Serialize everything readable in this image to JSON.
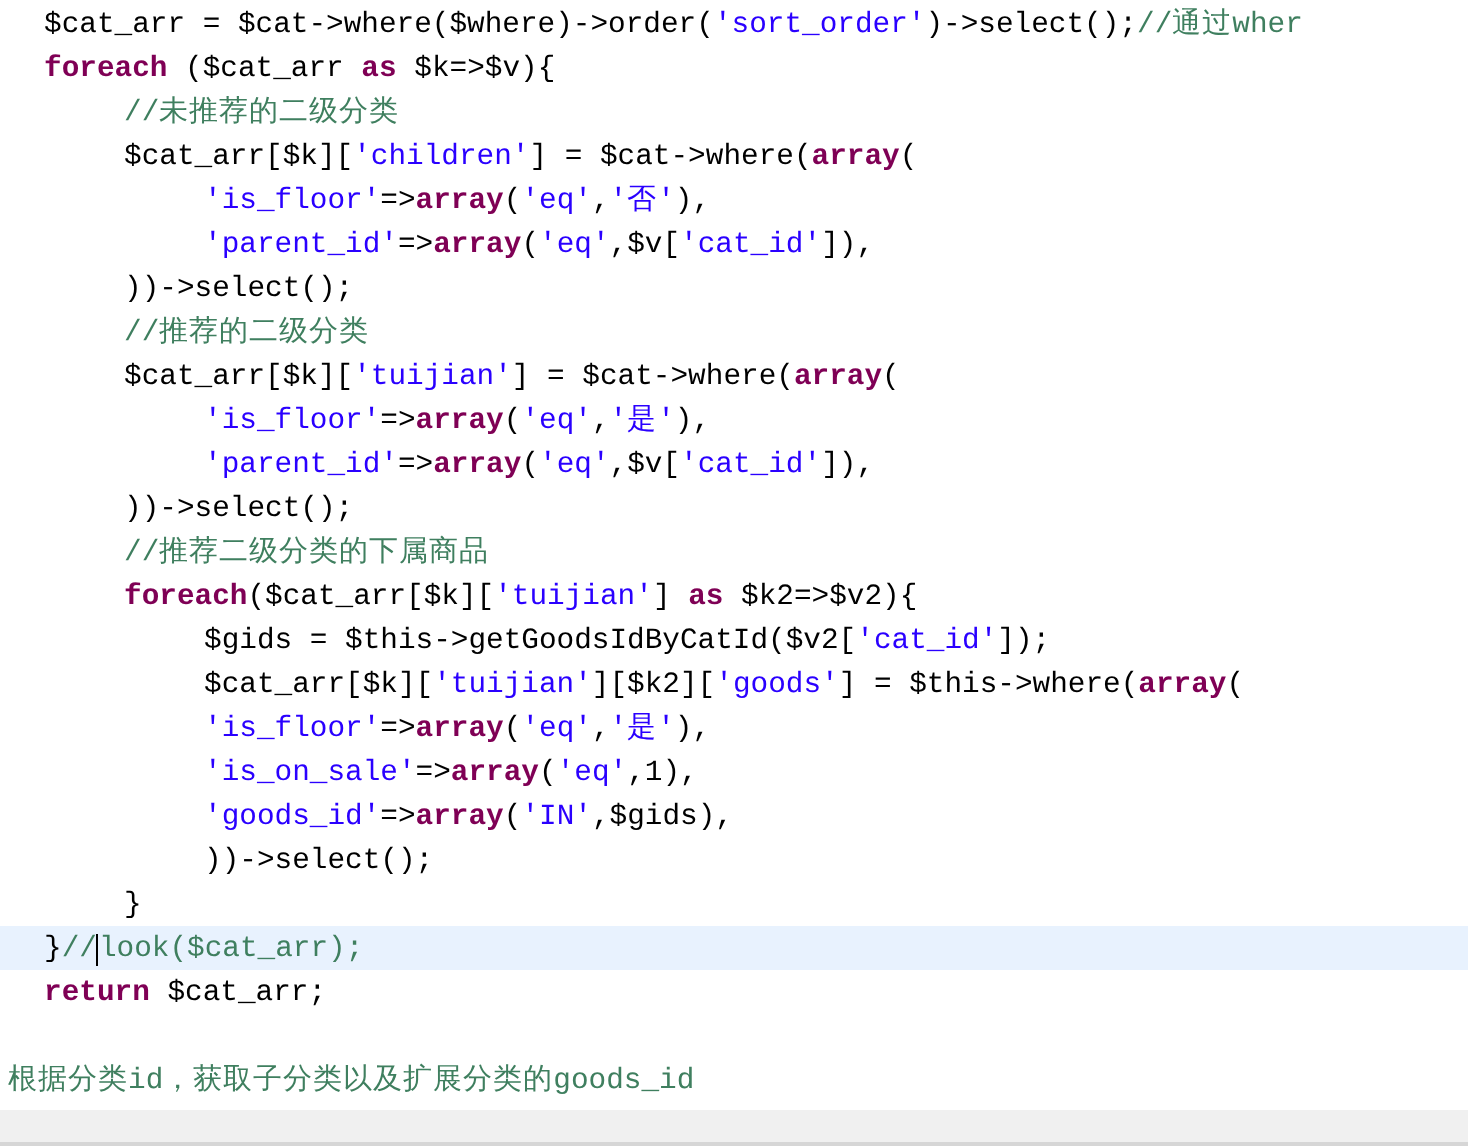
{
  "editor": {
    "blocks": [
      {
        "lines": [
          {
            "tokens": [
              {
                "kind": "plain",
                "text": "\t$cat_arr = $cat->where($where)->order("
              },
              {
                "kind": "string",
                "text": "'sort_order'"
              },
              {
                "kind": "plain",
                "text": ")->select();"
              },
              {
                "kind": "comment",
                "text": "//通过wher"
              }
            ]
          },
          {
            "tokens": [
              {
                "kind": "keyword",
                "text": "\tforeach"
              },
              {
                "kind": "plain",
                "text": " ($cat_arr "
              },
              {
                "kind": "keyword",
                "text": "as"
              },
              {
                "kind": "plain",
                "text": " $k=>$v){"
              }
            ]
          },
          {
            "tokens": [
              {
                "kind": "comment",
                "text": "\t\t//未推荐的二级分类"
              }
            ]
          },
          {
            "tokens": [
              {
                "kind": "plain",
                "text": "\t\t$cat_arr[$k]["
              },
              {
                "kind": "string",
                "text": "'children'"
              },
              {
                "kind": "plain",
                "text": "] = $cat->where("
              },
              {
                "kind": "keyword",
                "text": "array"
              },
              {
                "kind": "plain",
                "text": "("
              }
            ]
          },
          {
            "tokens": [
              {
                "kind": "string",
                "text": "\t\t\t'is_floor'"
              },
              {
                "kind": "plain",
                "text": "=>"
              },
              {
                "kind": "keyword",
                "text": "array"
              },
              {
                "kind": "plain",
                "text": "("
              },
              {
                "kind": "string",
                "text": "'eq'"
              },
              {
                "kind": "plain",
                "text": ","
              },
              {
                "kind": "string",
                "text": "'否'"
              },
              {
                "kind": "plain",
                "text": "),"
              }
            ]
          },
          {
            "tokens": [
              {
                "kind": "string",
                "text": "\t\t\t'parent_id'"
              },
              {
                "kind": "plain",
                "text": "=>"
              },
              {
                "kind": "keyword",
                "text": "array"
              },
              {
                "kind": "plain",
                "text": "("
              },
              {
                "kind": "string",
                "text": "'eq'"
              },
              {
                "kind": "plain",
                "text": ",$v["
              },
              {
                "kind": "string",
                "text": "'cat_id'"
              },
              {
                "kind": "plain",
                "text": "]),"
              }
            ]
          },
          {
            "tokens": [
              {
                "kind": "plain",
                "text": "\t\t))->select();"
              }
            ]
          },
          {
            "tokens": [
              {
                "kind": "comment",
                "text": "\t\t//推荐的二级分类"
              }
            ]
          },
          {
            "tokens": [
              {
                "kind": "plain",
                "text": "\t\t$cat_arr[$k]["
              },
              {
                "kind": "string",
                "text": "'tuijian'"
              },
              {
                "kind": "plain",
                "text": "] = $cat->where("
              },
              {
                "kind": "keyword",
                "text": "array"
              },
              {
                "kind": "plain",
                "text": "("
              }
            ]
          },
          {
            "tokens": [
              {
                "kind": "string",
                "text": "\t\t\t'is_floor'"
              },
              {
                "kind": "plain",
                "text": "=>"
              },
              {
                "kind": "keyword",
                "text": "array"
              },
              {
                "kind": "plain",
                "text": "("
              },
              {
                "kind": "string",
                "text": "'eq'"
              },
              {
                "kind": "plain",
                "text": ","
              },
              {
                "kind": "string",
                "text": "'是'"
              },
              {
                "kind": "plain",
                "text": "),"
              }
            ]
          },
          {
            "tokens": [
              {
                "kind": "string",
                "text": "\t\t\t'parent_id'"
              },
              {
                "kind": "plain",
                "text": "=>"
              },
              {
                "kind": "keyword",
                "text": "array"
              },
              {
                "kind": "plain",
                "text": "("
              },
              {
                "kind": "string",
                "text": "'eq'"
              },
              {
                "kind": "plain",
                "text": ",$v["
              },
              {
                "kind": "string",
                "text": "'cat_id'"
              },
              {
                "kind": "plain",
                "text": "]),"
              }
            ]
          },
          {
            "tokens": [
              {
                "kind": "plain",
                "text": "\t\t))->select();"
              }
            ]
          },
          {
            "tokens": [
              {
                "kind": "comment",
                "text": "\t\t//推荐二级分类的下属商品"
              }
            ]
          },
          {
            "tokens": [
              {
                "kind": "keyword",
                "text": "\t\tforeach"
              },
              {
                "kind": "plain",
                "text": "($cat_arr[$k]["
              },
              {
                "kind": "string",
                "text": "'tuijian'"
              },
              {
                "kind": "plain",
                "text": "] "
              },
              {
                "kind": "keyword",
                "text": "as"
              },
              {
                "kind": "plain",
                "text": " $k2=>$v2){"
              }
            ]
          },
          {
            "tokens": [
              {
                "kind": "plain",
                "text": "\t\t\t$gids = $this->getGoodsIdByCatId($v2["
              },
              {
                "kind": "string",
                "text": "'cat_id'"
              },
              {
                "kind": "plain",
                "text": "]);"
              }
            ]
          },
          {
            "tokens": [
              {
                "kind": "plain",
                "text": "\t\t\t$cat_arr[$k]["
              },
              {
                "kind": "string",
                "text": "'tuijian'"
              },
              {
                "kind": "plain",
                "text": "][$k2]["
              },
              {
                "kind": "string",
                "text": "'goods'"
              },
              {
                "kind": "plain",
                "text": "] = $this->where("
              },
              {
                "kind": "keyword",
                "text": "array"
              },
              {
                "kind": "plain",
                "text": "("
              }
            ]
          },
          {
            "tokens": [
              {
                "kind": "string",
                "text": "\t\t\t'is_floor'"
              },
              {
                "kind": "plain",
                "text": "=>"
              },
              {
                "kind": "keyword",
                "text": "array"
              },
              {
                "kind": "plain",
                "text": "("
              },
              {
                "kind": "string",
                "text": "'eq'"
              },
              {
                "kind": "plain",
                "text": ","
              },
              {
                "kind": "string",
                "text": "'是'"
              },
              {
                "kind": "plain",
                "text": "),"
              }
            ]
          },
          {
            "tokens": [
              {
                "kind": "string",
                "text": "\t\t\t'is_on_sale'"
              },
              {
                "kind": "plain",
                "text": "=>"
              },
              {
                "kind": "keyword",
                "text": "array"
              },
              {
                "kind": "plain",
                "text": "("
              },
              {
                "kind": "string",
                "text": "'eq'"
              },
              {
                "kind": "plain",
                "text": ",1),"
              }
            ]
          },
          {
            "tokens": [
              {
                "kind": "string",
                "text": "\t\t\t'goods_id'"
              },
              {
                "kind": "plain",
                "text": "=>"
              },
              {
                "kind": "keyword",
                "text": "array"
              },
              {
                "kind": "plain",
                "text": "("
              },
              {
                "kind": "string",
                "text": "'IN'"
              },
              {
                "kind": "plain",
                "text": ",$gids),"
              }
            ]
          },
          {
            "tokens": [
              {
                "kind": "plain",
                "text": "\t\t\t))->select();"
              }
            ]
          },
          {
            "tokens": [
              {
                "kind": "plain",
                "text": "\t\t}"
              }
            ]
          },
          {
            "current": true,
            "tokens": [
              {
                "kind": "plain",
                "text": "\t}"
              },
              {
                "kind": "comment",
                "text": "//"
              },
              {
                "kind": "comment",
                "text": "look($cat_arr);",
                "caret": true
              }
            ]
          },
          {
            "tokens": [
              {
                "kind": "keyword",
                "text": "\treturn"
              },
              {
                "kind": "plain",
                "text": " $cat_arr;"
              }
            ]
          }
        ]
      },
      {
        "lines": [
          {
            "tokens": [
              {
                "kind": "comment",
                "text": "根据分类id，获取子分类以及扩展分类的goods_id"
              }
            ]
          }
        ]
      }
    ]
  }
}
